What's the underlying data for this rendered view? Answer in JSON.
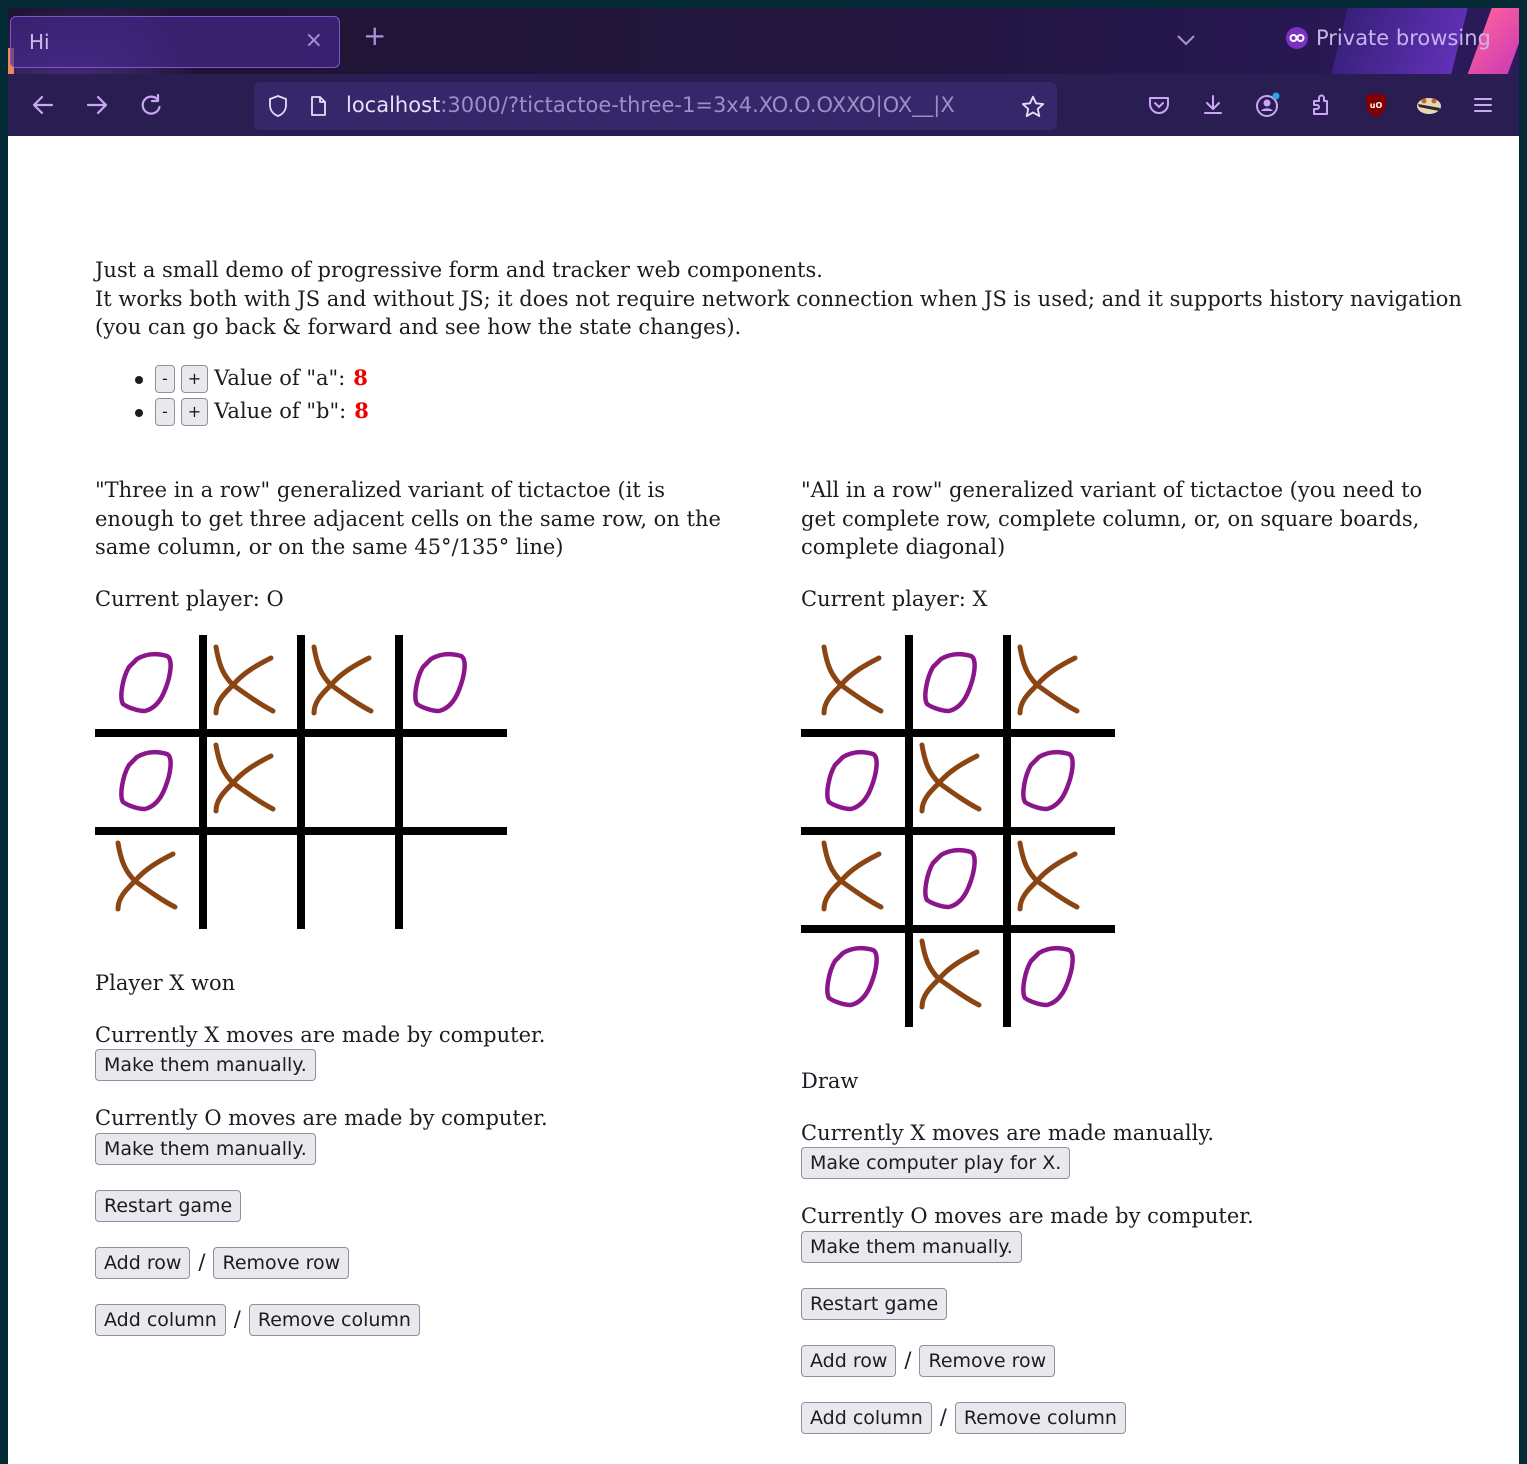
{
  "browser": {
    "tab_title": "Hi",
    "tab_close_icon": "×",
    "new_tab_icon": "+",
    "private_label": "Private browsing",
    "url_host": "localhost",
    "url_rest": ":3000/?tictactoe-three-1=3x4.XO.O.OXXO|OX__|X",
    "toolbar_icons": [
      "pocket-icon",
      "download-icon",
      "account-icon",
      "extensions-icon",
      "ublock-icon",
      "badger-icon",
      "menu-icon"
    ]
  },
  "intro": {
    "line1": "Just a small demo of progressive form and tracker web components.",
    "line2": "It works both with JS and without JS; it does not require network connection when JS is used; and it supports history navigation (you can go back & forward and see how the state changes)."
  },
  "counters": [
    {
      "minus": "-",
      "plus": "+",
      "label": "Value of \"a\":",
      "value": "8"
    },
    {
      "minus": "-",
      "plus": "+",
      "label": "Value of \"b\":",
      "value": "8"
    }
  ],
  "colors": {
    "x_mark": "#8b4513",
    "o_mark": "#8b168b",
    "grid": "#000000",
    "counter_value": "#ee0000"
  },
  "games": [
    {
      "description": "\"Three in a row\" generalized variant of tictactoe (it is enough to get three adjacent cells on the same row, on the same column, or on the same 45°/135° line)",
      "current_player": "Current player: O",
      "board": [
        [
          "O",
          "X",
          "X",
          "O"
        ],
        [
          "O",
          "X",
          "",
          ""
        ],
        [
          "X",
          "",
          "",
          ""
        ]
      ],
      "status": "Player X won",
      "x_mode_text": "Currently X moves are made by computer.",
      "x_mode_button": "Make them manually.",
      "o_mode_text": "Currently O moves are made by computer.",
      "o_mode_button": "Make them manually.",
      "restart": "Restart game",
      "add_row": "Add row",
      "remove_row": "Remove row",
      "add_column": "Add column",
      "remove_column": "Remove column",
      "separator": "/"
    },
    {
      "description": "\"All in a row\" generalized variant of tictactoe (you need to get complete row, complete column, or, on square boards, complete diagonal)",
      "current_player": "Current player: X",
      "board": [
        [
          "X",
          "O",
          "X"
        ],
        [
          "O",
          "X",
          "O"
        ],
        [
          "X",
          "O",
          "X"
        ],
        [
          "O",
          "X",
          "O"
        ]
      ],
      "status": "Draw",
      "x_mode_text": "Currently X moves are made manually.",
      "x_mode_button": "Make computer play for X.",
      "o_mode_text": "Currently O moves are made by computer.",
      "o_mode_button": "Make them manually.",
      "restart": "Restart game",
      "add_row": "Add row",
      "remove_row": "Remove row",
      "add_column": "Add column",
      "remove_column": "Remove column",
      "separator": "/"
    }
  ]
}
